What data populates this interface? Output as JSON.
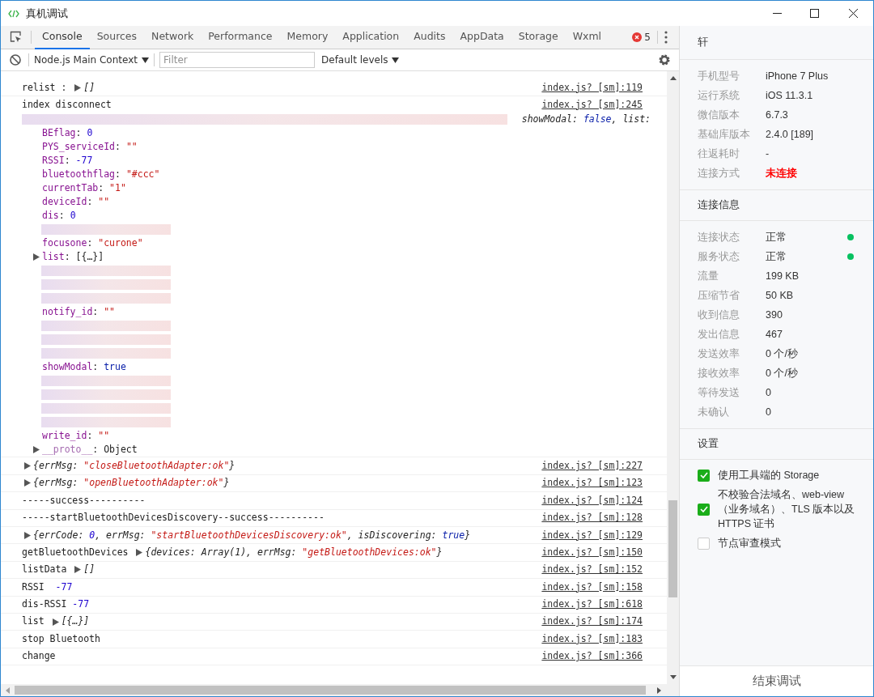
{
  "window": {
    "title": "真机调试"
  },
  "tabs": [
    {
      "label": "Console",
      "selected": true
    },
    {
      "label": "Sources",
      "selected": false
    },
    {
      "label": "Network",
      "selected": false
    },
    {
      "label": "Performance",
      "selected": false
    },
    {
      "label": "Memory",
      "selected": false
    },
    {
      "label": "Application",
      "selected": false
    },
    {
      "label": "Audits",
      "selected": false
    },
    {
      "label": "AppData",
      "selected": false
    },
    {
      "label": "Storage",
      "selected": false
    },
    {
      "label": "Wxml",
      "selected": false
    }
  ],
  "error_count": "5",
  "toolbar": {
    "context": "Node.js Main Context",
    "filter_placeholder": "Filter",
    "levels": "Default levels"
  },
  "console": {
    "rows": [
      {
        "kind": "log",
        "segments": [
          {
            "kind": "text",
            "italic": false,
            "tokens": [
              {
                "text": "relist : ",
                "kind": "plain"
              }
            ]
          },
          {
            "kind": "arrow"
          },
          {
            "kind": "text",
            "italic": true,
            "tokens": [
              {
                "text": "[]",
                "kind": "plain"
              }
            ]
          }
        ],
        "source": "index.js? [sm]:119"
      },
      {
        "kind": "object",
        "segments": [
          {
            "kind": "text",
            "italic": false,
            "tokens": [
              {
                "text": "index disconnect",
                "kind": "plain"
              }
            ]
          }
        ],
        "source": "index.js? [sm]:245",
        "preview": {
          "italic": true,
          "tokens": [
            {
              "text": "showModal: ",
              "kind": "plain"
            },
            {
              "text": "false",
              "kind": "bool"
            },
            {
              "text": ", list:",
              "kind": "plain"
            }
          ]
        },
        "properties": [
          {
            "kind": "redacted"
          },
          {
            "kind": "prop",
            "expandable": false,
            "tokens": [
              {
                "text": "BEflag",
                "kind": "key"
              },
              {
                "text": ": ",
                "kind": "plain"
              },
              {
                "text": "0",
                "kind": "num"
              }
            ]
          },
          {
            "kind": "prop",
            "expandable": false,
            "tokens": [
              {
                "text": "PYS_serviceId",
                "kind": "key"
              },
              {
                "text": ": ",
                "kind": "plain"
              },
              {
                "text": "\"\"",
                "kind": "str"
              }
            ]
          },
          {
            "kind": "prop",
            "expandable": false,
            "tokens": [
              {
                "text": "RSSI",
                "kind": "key"
              },
              {
                "text": ": ",
                "kind": "plain"
              },
              {
                "text": "-77",
                "kind": "num"
              }
            ]
          },
          {
            "kind": "prop",
            "expandable": false,
            "tokens": [
              {
                "text": "bluetoothflag",
                "kind": "key"
              },
              {
                "text": ": ",
                "kind": "plain"
              },
              {
                "text": "\"#ccc\"",
                "kind": "str"
              }
            ]
          },
          {
            "kind": "prop",
            "expandable": false,
            "tokens": [
              {
                "text": "currentTab",
                "kind": "key"
              },
              {
                "text": ": ",
                "kind": "plain"
              },
              {
                "text": "\"1\"",
                "kind": "str"
              }
            ]
          },
          {
            "kind": "prop",
            "expandable": false,
            "tokens": [
              {
                "text": "deviceId",
                "kind": "key"
              },
              {
                "text": ": ",
                "kind": "plain"
              },
              {
                "text": "\"\"",
                "kind": "str"
              }
            ]
          },
          {
            "kind": "prop",
            "expandable": false,
            "tokens": [
              {
                "text": "dis",
                "kind": "key"
              },
              {
                "text": ": ",
                "kind": "plain"
              },
              {
                "text": "0",
                "kind": "num"
              }
            ]
          },
          {
            "kind": "redacted"
          },
          {
            "kind": "prop",
            "expandable": false,
            "tokens": [
              {
                "text": "focusone",
                "kind": "key"
              },
              {
                "text": ": ",
                "kind": "plain"
              },
              {
                "text": "\"curone\"",
                "kind": "str"
              }
            ]
          },
          {
            "kind": "prop",
            "expandable": true,
            "tokens": [
              {
                "text": "list",
                "kind": "key"
              },
              {
                "text": ": [{…}]",
                "kind": "plain"
              }
            ]
          },
          {
            "kind": "redacted"
          },
          {
            "kind": "redacted"
          },
          {
            "kind": "redacted"
          },
          {
            "kind": "prop",
            "expandable": false,
            "tokens": [
              {
                "text": "notify_id",
                "kind": "key"
              },
              {
                "text": ": ",
                "kind": "plain"
              },
              {
                "text": "\"\"",
                "kind": "str"
              }
            ]
          },
          {
            "kind": "redacted"
          },
          {
            "kind": "redacted"
          },
          {
            "kind": "redacted"
          },
          {
            "kind": "prop",
            "expandable": false,
            "tokens": [
              {
                "text": "showModal",
                "kind": "key"
              },
              {
                "text": ": ",
                "kind": "plain"
              },
              {
                "text": "true",
                "kind": "bool"
              }
            ]
          },
          {
            "kind": "redacted"
          },
          {
            "kind": "redacted"
          },
          {
            "kind": "redacted"
          },
          {
            "kind": "redacted"
          },
          {
            "kind": "prop",
            "expandable": false,
            "tokens": [
              {
                "text": "write_id",
                "kind": "key"
              },
              {
                "text": ": ",
                "kind": "plain"
              },
              {
                "text": "\"\"",
                "kind": "str"
              }
            ]
          },
          {
            "kind": "prop",
            "expandable": true,
            "tokens": [
              {
                "text": "__proto__",
                "kind": "proto"
              },
              {
                "text": ": Object",
                "kind": "plain"
              }
            ]
          }
        ]
      },
      {
        "kind": "log",
        "segments": [
          {
            "kind": "arrow"
          },
          {
            "kind": "text",
            "italic": true,
            "tokens": [
              {
                "text": "{errMsg: ",
                "kind": "plain"
              },
              {
                "text": "\"closeBluetoothAdapter:ok\"",
                "kind": "str"
              },
              {
                "text": "}",
                "kind": "plain"
              }
            ]
          }
        ],
        "source": "index.js? [sm]:227"
      },
      {
        "kind": "log",
        "segments": [
          {
            "kind": "arrow"
          },
          {
            "kind": "text",
            "italic": true,
            "tokens": [
              {
                "text": "{errMsg: ",
                "kind": "plain"
              },
              {
                "text": "\"openBluetoothAdapter:ok\"",
                "kind": "str"
              },
              {
                "text": "}",
                "kind": "plain"
              }
            ]
          }
        ],
        "source": "index.js? [sm]:123"
      },
      {
        "kind": "log",
        "segments": [
          {
            "kind": "text",
            "italic": false,
            "tokens": [
              {
                "text": "-----success----------",
                "kind": "plain"
              }
            ]
          }
        ],
        "source": "index.js? [sm]:124"
      },
      {
        "kind": "log",
        "segments": [
          {
            "kind": "text",
            "italic": false,
            "tokens": [
              {
                "text": "-----startBluetoothDevicesDiscovery--success----------",
                "kind": "plain"
              }
            ]
          }
        ],
        "source": "index.js? [sm]:128"
      },
      {
        "kind": "log",
        "segments": [
          {
            "kind": "arrow"
          },
          {
            "kind": "text",
            "italic": true,
            "tokens": [
              {
                "text": "{errCode: ",
                "kind": "plain"
              },
              {
                "text": "0",
                "kind": "num"
              },
              {
                "text": ", errMsg: ",
                "kind": "plain"
              },
              {
                "text": "\"startBluetoothDevicesDiscovery:ok\"",
                "kind": "str"
              },
              {
                "text": ", isDiscovering: ",
                "kind": "plain"
              },
              {
                "text": "true",
                "kind": "bool"
              },
              {
                "text": "}",
                "kind": "plain"
              }
            ]
          }
        ],
        "source": "index.js? [sm]:129"
      },
      {
        "kind": "log",
        "segments": [
          {
            "kind": "text",
            "italic": false,
            "tokens": [
              {
                "text": "getBluetoothDevices ",
                "kind": "plain"
              }
            ]
          },
          {
            "kind": "arrow"
          },
          {
            "kind": "text",
            "italic": true,
            "tokens": [
              {
                "text": "{devices: Array(1), errMsg: ",
                "kind": "plain"
              },
              {
                "text": "\"getBluetoothDevices:ok\"",
                "kind": "str"
              },
              {
                "text": "}",
                "kind": "plain"
              }
            ]
          }
        ],
        "source": "index.js? [sm]:150"
      },
      {
        "kind": "log",
        "segments": [
          {
            "kind": "text",
            "italic": false,
            "tokens": [
              {
                "text": "listData ",
                "kind": "plain"
              }
            ]
          },
          {
            "kind": "arrow"
          },
          {
            "kind": "text",
            "italic": true,
            "tokens": [
              {
                "text": "[]",
                "kind": "plain"
              }
            ]
          }
        ],
        "source": "index.js? [sm]:152"
      },
      {
        "kind": "log",
        "segments": [
          {
            "kind": "text",
            "italic": false,
            "tokens": [
              {
                "text": "RSSI  ",
                "kind": "plain"
              },
              {
                "text": "-77",
                "kind": "num"
              }
            ]
          }
        ],
        "source": "index.js? [sm]:158"
      },
      {
        "kind": "log",
        "segments": [
          {
            "kind": "text",
            "italic": false,
            "tokens": [
              {
                "text": "dis-RSSI ",
                "kind": "plain"
              },
              {
                "text": "-77",
                "kind": "num"
              }
            ]
          }
        ],
        "source": "index.js? [sm]:618"
      },
      {
        "kind": "log",
        "segments": [
          {
            "kind": "text",
            "italic": false,
            "tokens": [
              {
                "text": "list ",
                "kind": "plain"
              }
            ]
          },
          {
            "kind": "arrow"
          },
          {
            "kind": "text",
            "italic": true,
            "tokens": [
              {
                "text": "[{…}]",
                "kind": "plain"
              }
            ]
          }
        ],
        "source": "index.js? [sm]:174"
      },
      {
        "kind": "log",
        "segments": [
          {
            "kind": "text",
            "italic": false,
            "tokens": [
              {
                "text": "stop Bluetooth",
                "kind": "plain"
              }
            ]
          }
        ],
        "source": "index.js? [sm]:183"
      },
      {
        "kind": "log",
        "segments": [
          {
            "kind": "text",
            "italic": false,
            "tokens": [
              {
                "text": "change",
                "kind": "plain"
              }
            ]
          }
        ],
        "source": "index.js? [sm]:366"
      }
    ]
  },
  "sidebar": {
    "title": "轩",
    "device_info": [
      {
        "label": "手机型号",
        "value": "iPhone 7 Plus",
        "alert": false
      },
      {
        "label": "运行系统",
        "value": "iOS 11.3.1",
        "alert": false
      },
      {
        "label": "微信版本",
        "value": "6.7.3",
        "alert": false
      },
      {
        "label": "基础库版本",
        "value": "2.4.0 [189]",
        "alert": false
      },
      {
        "label": "往返耗时",
        "value": "-",
        "alert": false
      },
      {
        "label": "连接方式",
        "value": "未连接",
        "alert": true
      }
    ],
    "connection": {
      "title": "连接信息",
      "rows": [
        {
          "label": "连接状态",
          "value": "正常",
          "color": "#07c160"
        },
        {
          "label": "服务状态",
          "value": "正常",
          "color": "#07c160"
        },
        {
          "label": "流量",
          "value": "199 KB"
        },
        {
          "label": "压缩节省",
          "value": "50 KB"
        },
        {
          "label": "收到信息",
          "value": "390"
        },
        {
          "label": "发出信息",
          "value": "467"
        },
        {
          "label": "发送效率",
          "value": "0 个/秒"
        },
        {
          "label": "接收效率",
          "value": "0 个/秒"
        },
        {
          "label": "等待发送",
          "value": "0"
        },
        {
          "label": "未确认",
          "value": "0"
        }
      ]
    },
    "settings": {
      "title": "设置",
      "options": [
        {
          "label": "使用工具端的 Storage",
          "checked": true
        },
        {
          "label": "不校验合法域名、web-view（业务域名）、TLS 版本以及 HTTPS 证书",
          "checked": true
        },
        {
          "label": "节点审查模式",
          "checked": false
        }
      ]
    },
    "end_button": "结束调试"
  }
}
